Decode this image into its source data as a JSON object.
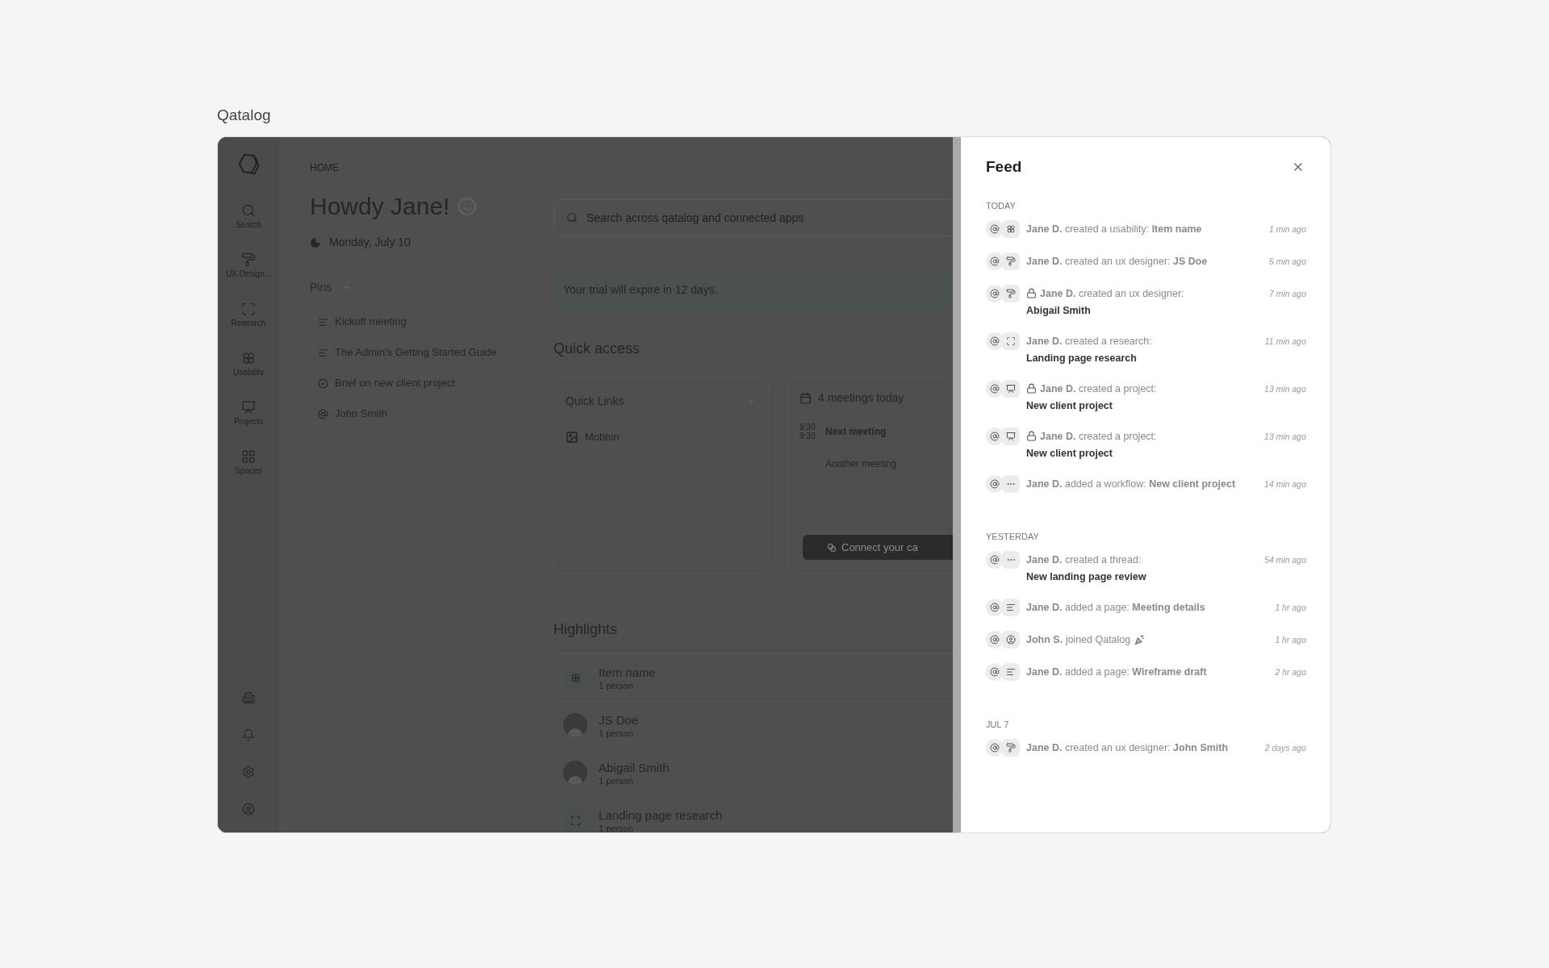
{
  "page_title": "Qatalog",
  "nav": {
    "items": [
      {
        "label": "Search",
        "kind": "search"
      },
      {
        "label": "UX Design...",
        "kind": "designer"
      },
      {
        "label": "Research",
        "kind": "research"
      },
      {
        "label": "Usability",
        "kind": "usability"
      },
      {
        "label": "Projects",
        "kind": "project"
      },
      {
        "label": "Spaces",
        "kind": "grid"
      }
    ],
    "bottom": [
      {
        "kind": "building"
      },
      {
        "kind": "bell"
      },
      {
        "kind": "settings"
      },
      {
        "kind": "user"
      }
    ]
  },
  "breadcrumb": "HOME",
  "greeting": "Howdy Jane!",
  "date": "Monday, July 10",
  "pins": {
    "title": "Pins",
    "items": [
      {
        "label": "Kickoff meeting",
        "kind": "page"
      },
      {
        "label": "The Admin's Getting Started Guide",
        "kind": "page"
      },
      {
        "label": "Brief on new client project",
        "kind": "task"
      },
      {
        "label": "John Smith",
        "kind": "person"
      }
    ]
  },
  "search": {
    "placeholder": "Search across qatalog and connected apps"
  },
  "trial_banner": "Your trial will expire in 12 days.",
  "quick_access": {
    "title": "Quick access",
    "links_card": {
      "title": "Quick Links",
      "items": [
        "Mobbin"
      ]
    },
    "meetings_card": {
      "title": "4 meetings today",
      "meetings": [
        {
          "start": "9:30",
          "end": "9:30",
          "title": "Next meeting",
          "upcoming": true
        },
        {
          "title": "Another meeting",
          "upcoming": false
        }
      ],
      "connect_button": "Connect your ca"
    }
  },
  "highlights": {
    "title": "Highlights",
    "rows": [
      {
        "title": "Item name",
        "subtitle": "1 person",
        "kind": "usability"
      },
      {
        "title": "JS Doe",
        "subtitle": "1 person",
        "kind": "person"
      },
      {
        "title": "Abigail Smith",
        "subtitle": "1 person",
        "kind": "person"
      },
      {
        "title": "Landing page research",
        "subtitle": "1 person",
        "kind": "research"
      }
    ]
  },
  "feed": {
    "title": "Feed",
    "groups": [
      {
        "label": "TODAY",
        "items": [
          {
            "kind": "usability",
            "locked": false,
            "text": "**Jane D.** created a usability: **Item name**",
            "time": "1 min ago"
          },
          {
            "kind": "designer",
            "locked": false,
            "text": "**Jane D.** created an ux designer: **JS Doe**",
            "time": "5 min ago"
          },
          {
            "kind": "designer",
            "locked": true,
            "text": "**Jane D.** created an ux designer:",
            "detail": "Abigail Smith",
            "time": "7 min ago"
          },
          {
            "kind": "research",
            "locked": false,
            "text": "**Jane D.** created a research:",
            "detail": "Landing page research",
            "time": "11 min ago"
          },
          {
            "kind": "project",
            "locked": true,
            "text": "**Jane D.** created a project:",
            "detail": "New client project",
            "time": "13 min ago"
          },
          {
            "kind": "project",
            "locked": true,
            "text": "**Jane D.** created a project:",
            "detail": "New client project",
            "time": "13 min ago"
          },
          {
            "kind": "workflow",
            "locked": false,
            "text": "**Jane D.** added a workflow: **New client project**",
            "time": "14 min ago"
          }
        ]
      },
      {
        "label": "YESTERDAY",
        "items": [
          {
            "kind": "workflow",
            "locked": false,
            "text": "**Jane D.** created a thread:",
            "detail": "New landing page review",
            "time": "54 min ago"
          },
          {
            "kind": "page",
            "locked": false,
            "text": "**Jane D.** added a page: **Meeting details**",
            "time": "1 hr ago"
          },
          {
            "kind": "user",
            "locked": false,
            "celebrate": true,
            "text": "**John S.** joined Qatalog",
            "time": "1 hr ago"
          },
          {
            "kind": "page",
            "locked": false,
            "text": "**Jane D.** added a page: **Wireframe draft**",
            "time": "2 hr ago"
          }
        ]
      },
      {
        "label": "JUL 7",
        "items": [
          {
            "kind": "designer",
            "locked": false,
            "text": "**Jane D.** created an ux designer: **John Smith**",
            "time": "2 days ago"
          }
        ]
      }
    ]
  }
}
